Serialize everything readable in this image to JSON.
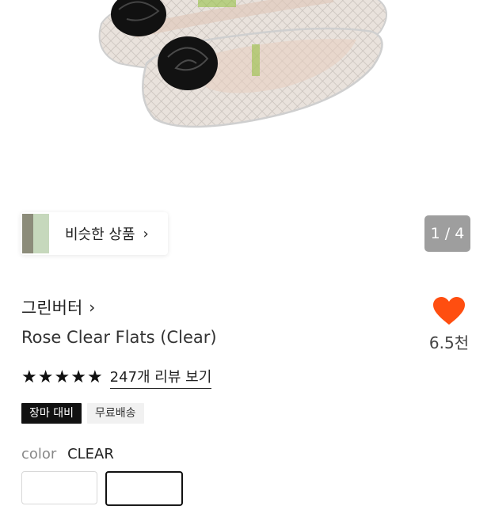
{
  "gallery": {
    "pager_current": "1",
    "pager_total": "4",
    "pager_text": "1 / 4"
  },
  "similar": {
    "label": "비슷한 상품",
    "chevron": "›"
  },
  "product": {
    "brand": "그린버터",
    "brand_chevron": "›",
    "title": "Rose Clear Flats (Clear)",
    "like_count": "6.5천",
    "rating_stars": 5,
    "review_link": "247개 리뷰 보기",
    "badges": [
      "장마 대비",
      "무료배송"
    ],
    "color_label": "color",
    "color_value": "CLEAR"
  },
  "icons": {
    "heart": "heart-icon",
    "star": "star-icon",
    "chevron": "chevron-right-icon"
  },
  "colors": {
    "heart": "#ff4e10",
    "pager_bg": "#9e9e9e",
    "badge_dark": "#111111",
    "badge_light": "#f1f1f1"
  }
}
